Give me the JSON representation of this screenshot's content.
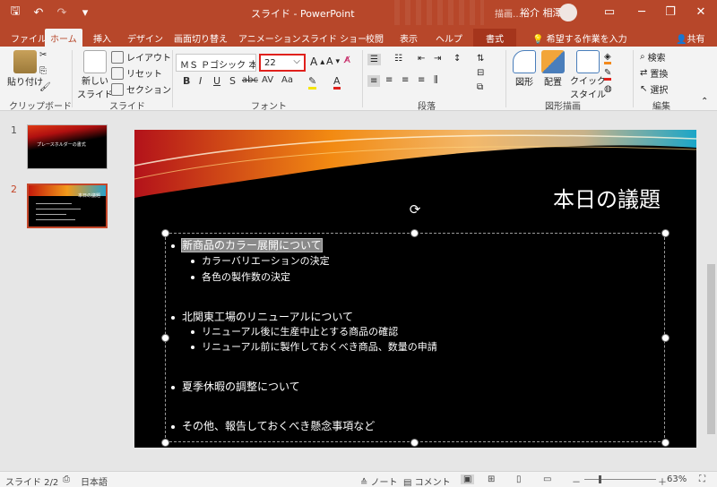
{
  "titlebar": {
    "title": "スライド  -  PowerPoint",
    "context_group": "描画…",
    "user": "裕介 相澤",
    "min": "─",
    "restore": "❐",
    "close": "✕",
    "qat_save": "🖫",
    "qat_undo": "↶",
    "qat_redo": "↷",
    "qat_custom": "▾"
  },
  "tabs": [
    "ファイル",
    "ホーム",
    "挿入",
    "デザイン",
    "画面切り替え",
    "アニメーション",
    "スライド ショー",
    "校閲",
    "表示",
    "ヘルプ",
    "書式"
  ],
  "tellme": "希望する作業を入力",
  "share": "共有",
  "ribbon": {
    "paste": "貼り付け",
    "clipboard": "クリップボード",
    "new_slide_1": "新しい",
    "new_slide_2": "スライド",
    "layout": "レイアウト",
    "reset": "リセット",
    "section": "セクション",
    "slides_group": "スライド",
    "font_name": "ＭＳ Ｐゴシック 本文",
    "font_size": "22",
    "font_group": "フォント",
    "bold": "B",
    "italic": "I",
    "underline": "U",
    "shadow": "S",
    "strike": "abc",
    "spacing": "AV",
    "case": "Aa",
    "paragraph_group": "段落",
    "shape": "図形",
    "arrange": "配置",
    "quickstyle_1": "クイック",
    "quickstyle_2": "スタイル",
    "drawing_group": "図形描画",
    "find": "検索",
    "replace": "置換",
    "select": "選択",
    "editing_group": "編集"
  },
  "thumbnails": [
    {
      "num": "1",
      "title": "プレースホルダーの書式"
    },
    {
      "num": "2",
      "title": "本日の議題"
    }
  ],
  "slide": {
    "title": "本日の議題",
    "bullets": [
      {
        "text": "新商品のカラー展開について",
        "sub": [
          "カラーバリエーションの決定",
          "各色の製作数の決定"
        ]
      },
      {
        "text": "北関東工場のリニューアルについて",
        "sub": [
          "リニューアル後に生産中止とする商品の確認",
          "リニューアル前に製作しておくべき商品、数量の申請"
        ]
      },
      {
        "text": "夏季休暇の調整について",
        "sub": []
      },
      {
        "text": "その他、報告しておくべき懸念事項など",
        "sub": []
      }
    ]
  },
  "status": {
    "slide": "スライド 2/2",
    "lang": "日本語",
    "notes": "ノート",
    "comments": "コメント",
    "zoom": "63%",
    "minus": "－",
    "plus": "＋"
  },
  "colors": {
    "accent": "#b7472a",
    "highlight_box": "#e0201c",
    "slide_bg": "#000000"
  }
}
